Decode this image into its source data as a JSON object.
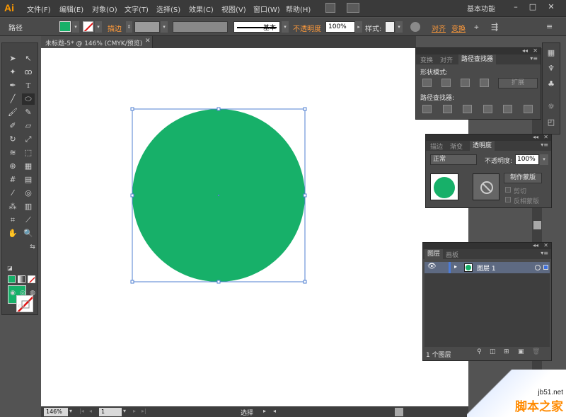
{
  "app": {
    "logo": "Ai"
  },
  "menu": [
    "文件(F)",
    "编辑(E)",
    "对象(O)",
    "文字(T)",
    "选择(S)",
    "效果(C)",
    "视图(V)",
    "窗口(W)",
    "帮助(H)"
  ],
  "workspace": "基本功能",
  "window_controls": {
    "minimize": "–",
    "maximize": "□",
    "close": "✕"
  },
  "control_bar": {
    "path_label": "路径",
    "stroke_label": "描边",
    "stroke_style": "基本",
    "opacity_label": "不透明度",
    "opacity_value": "100%",
    "style_label": "样式:",
    "align_label": "对齐",
    "transform_label": "变换"
  },
  "colors": {
    "fill": "#17b069",
    "accent": "#ff9a3a"
  },
  "document": {
    "tab_title": "未标题-5* @ 146% (CMYK/预览)",
    "close": "✕"
  },
  "status_bar": {
    "zoom": "146%",
    "artboard": "1",
    "status": "选择"
  },
  "pathfinder_panel": {
    "tabs": [
      "变换",
      "对齐",
      "路径查找器"
    ],
    "shape_modes_label": "形状模式:",
    "expand_label": "扩展",
    "pathfinders_label": "路径查找器:"
  },
  "transparency_panel": {
    "tabs": [
      "描边",
      "渐变",
      "透明度"
    ],
    "blend_mode": "正常",
    "opacity_label": "不透明度:",
    "opacity_value": "100%",
    "make_mask_label": "制作蒙版",
    "clip_label": "剪切",
    "invert_label": "反相蒙版"
  },
  "layers_panel": {
    "tabs": [
      "图层",
      "画板"
    ],
    "layer_name": "图层 1",
    "count_label": "1 个图层"
  },
  "watermark": {
    "url": "jb51.net",
    "name": "脚本之家"
  }
}
